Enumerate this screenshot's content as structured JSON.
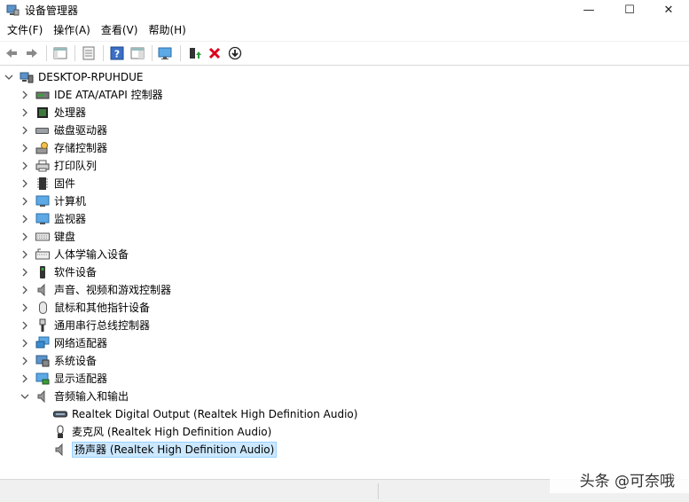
{
  "window": {
    "title": "设备管理器",
    "min_glyph": "—",
    "max_glyph": "☐",
    "close_glyph": "✕"
  },
  "menu": [
    {
      "label": "文件(F)"
    },
    {
      "label": "操作(A)"
    },
    {
      "label": "查看(V)"
    },
    {
      "label": "帮助(H)"
    }
  ],
  "toolbar": {
    "buttons": [
      "back-icon",
      "forward-icon",
      "properties-icon",
      "show-hide-icon",
      "help-icon",
      "view-icon",
      "monitor-scan-icon",
      "update-driver-icon",
      "uninstall-icon",
      "disable-icon"
    ]
  },
  "tree": {
    "root": {
      "label": "DESKTOP-RPUHDUE",
      "expanded": true
    },
    "categories": [
      {
        "label": "IDE ATA/ATAPI 控制器",
        "icon": "ide-icon"
      },
      {
        "label": "处理器",
        "icon": "processor-icon"
      },
      {
        "label": "磁盘驱动器",
        "icon": "disk-icon"
      },
      {
        "label": "存储控制器",
        "icon": "storage-controller-icon"
      },
      {
        "label": "打印队列",
        "icon": "printer-icon"
      },
      {
        "label": "固件",
        "icon": "firmware-icon"
      },
      {
        "label": "计算机",
        "icon": "computer-icon"
      },
      {
        "label": "监视器",
        "icon": "monitor-icon"
      },
      {
        "label": "键盘",
        "icon": "keyboard-icon"
      },
      {
        "label": "人体学输入设备",
        "icon": "hid-icon"
      },
      {
        "label": "软件设备",
        "icon": "software-device-icon"
      },
      {
        "label": "声音、视频和游戏控制器",
        "icon": "sound-icon"
      },
      {
        "label": "鼠标和其他指针设备",
        "icon": "mouse-icon"
      },
      {
        "label": "通用串行总线控制器",
        "icon": "usb-icon"
      },
      {
        "label": "网络适配器",
        "icon": "network-icon"
      },
      {
        "label": "系统设备",
        "icon": "system-icon"
      },
      {
        "label": "显示适配器",
        "icon": "display-adapter-icon"
      },
      {
        "label": "音频输入和输出",
        "icon": "audio-io-icon",
        "expanded": true
      }
    ],
    "audio_children": [
      {
        "label": "Realtek Digital Output (Realtek High Definition Audio)",
        "icon": "digital-output-icon"
      },
      {
        "label": "麦克风 (Realtek High Definition Audio)",
        "icon": "microphone-icon"
      },
      {
        "label": "扬声器 (Realtek High Definition Audio)",
        "icon": "speaker-icon",
        "selected": true
      }
    ]
  },
  "watermark": "头条 @可奈哦",
  "colors": {
    "selection_bg": "#cce8ff",
    "selection_border": "#99d1ff",
    "uninstall_red": "#d9001b",
    "update_green": "#2e9e3e"
  }
}
